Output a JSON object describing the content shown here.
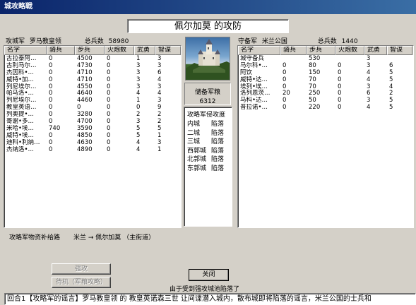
{
  "window": {
    "title": "城攻略戦"
  },
  "battle_title": "佩尔加莫 的攻防",
  "attacker": {
    "side_label": "攻城军",
    "commander": "罗马教皇领",
    "total_label": "总兵数",
    "total_value": "58980",
    "columns": [
      "名字",
      "骑兵",
      "步兵",
      "火炮数",
      "武勇",
      "智谋"
    ],
    "rows": [
      [
        "古拉泰阿…",
        "0",
        "4500",
        "0",
        "1",
        "3"
      ],
      [
        "古利马尔…",
        "0",
        "4730",
        "0",
        "3",
        "3"
      ],
      [
        "杰因科•…",
        "0",
        "4710",
        "0",
        "3",
        "6"
      ],
      [
        "威特•加…",
        "0",
        "4710",
        "0",
        "3",
        "4"
      ],
      [
        "列尼埃尔…",
        "0",
        "4550",
        "0",
        "3",
        "3"
      ],
      [
        "帕马洛•…",
        "0",
        "4640",
        "0",
        "4",
        "4"
      ],
      [
        "列尼埃尔…",
        "0",
        "4460",
        "0",
        "1",
        "3"
      ],
      [
        "教皇英语…",
        "0",
        "0",
        "0",
        "0",
        "9"
      ],
      [
        "列奥提•…",
        "0",
        "3280",
        "0",
        "2",
        "2"
      ],
      [
        "哥谢•多…",
        "0",
        "4700",
        "0",
        "3",
        "2"
      ],
      [
        "米哈•埃…",
        "740",
        "3590",
        "0",
        "5",
        "5"
      ],
      [
        "威特•埃…",
        "0",
        "4850",
        "0",
        "5",
        "1"
      ],
      [
        "迪科•利纳…",
        "0",
        "4630",
        "0",
        "4",
        "3"
      ],
      [
        "杰纳洛•…",
        "0",
        "4890",
        "0",
        "4",
        "1"
      ]
    ]
  },
  "defender": {
    "side_label": "守备军",
    "commander": "米兰公国",
    "total_label": "总兵数",
    "total_value": "1440",
    "columns": [
      "名字",
      "骑兵",
      "步兵",
      "火炮数",
      "武勇",
      "智谋"
    ],
    "rows": [
      [
        "城守备兵",
        "",
        "530",
        "",
        "3",
        ""
      ],
      [
        "马尔科•…",
        "0",
        "80",
        "0",
        "3",
        "6"
      ],
      [
        "阿饮",
        "0",
        "150",
        "0",
        "4",
        "5"
      ],
      [
        "威特•达…",
        "0",
        "70",
        "0",
        "4",
        "5"
      ],
      [
        "埃列•埃…",
        "0",
        "70",
        "0",
        "3",
        "4"
      ],
      [
        "洛列恩茨…",
        "20",
        "250",
        "0",
        "6",
        "2"
      ],
      [
        "马科•达…",
        "0",
        "50",
        "0",
        "3",
        "5"
      ],
      [
        "普拉诺•…",
        "0",
        "220",
        "0",
        "4",
        "5"
      ]
    ]
  },
  "reserve": {
    "label": "储备军粮",
    "value": "6312"
  },
  "attack_progress": {
    "title": "攻略军侵攻度",
    "cities": [
      {
        "name": "内城",
        "status": "陷落"
      },
      {
        "name": "二城",
        "status": "陷落"
      },
      {
        "name": "三城",
        "status": "陷落"
      },
      {
        "name": "西郭城",
        "status": "陷落"
      },
      {
        "name": "北郭城",
        "status": "陷落"
      },
      {
        "name": "东郭城",
        "status": "陷落"
      }
    ]
  },
  "supply": {
    "label": "攻略军物资补给路",
    "route": "米兰 → 佩尔加莫 （主街道）"
  },
  "buttons": {
    "assault": "强攻",
    "wait": "待机（军粮攻略）",
    "close": "关闭"
  },
  "status_message": "由于受到强攻城池陷落了",
  "ticker": "回合1【攻略军的谣言】罗马教皇领 的 教皇英诺森三世 让间谍潜入城内，散布城即将陷落的谣言，米兰公国的士兵和"
}
